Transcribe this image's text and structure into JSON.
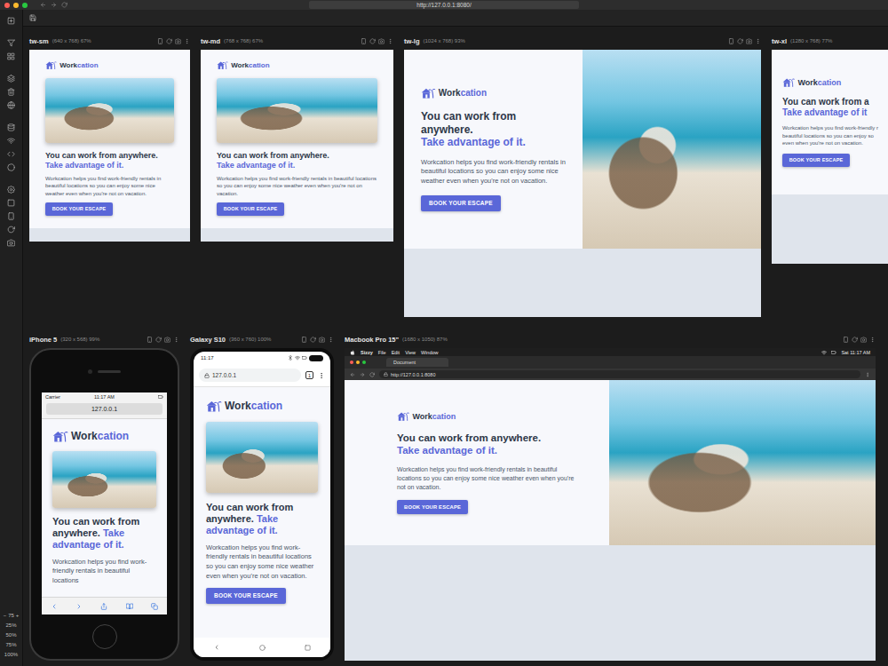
{
  "app": {
    "url": "http://127.0.0.1:8080/"
  },
  "zoom": {
    "decrease": "−",
    "value": "75",
    "increase": "+",
    "presets": [
      "25%",
      "50%",
      "75%",
      "100%"
    ]
  },
  "page": {
    "brand": [
      "Work",
      "cation"
    ],
    "headline": "You can work from anywhere.",
    "accent": "Take advantage of it.",
    "body": "Workcation helps you find work-friendly rentals in beautiful locations so you can enjoy some nice weather even when you're not on vacation.",
    "cta": "BOOK YOUR ESCAPE"
  },
  "device_rows": [
    {
      "devices": [
        {
          "name": "tw-sm",
          "meta": "(640 x 768) 67%",
          "kind": "viewport-stacked"
        },
        {
          "name": "tw-md",
          "meta": "(768 x 768) 67%",
          "kind": "viewport-stacked"
        },
        {
          "name": "tw-lg",
          "meta": "(1024 x 768) 93%",
          "kind": "viewport-split"
        },
        {
          "name": "tw-xl",
          "meta": "(1280 x 768) 77%",
          "kind": "viewport-clipped",
          "page": {
            "headline": "You can work from a",
            "accent": "Take advantage of it",
            "body_lines": [
              "Workcation helps you find work-friendly r",
              "beautiful locations so you can enjoy so",
              "even when you're not on vacation."
            ]
          }
        }
      ]
    },
    {
      "devices": [
        {
          "name": "iPhone 5",
          "meta": "(320 x 568) 99%",
          "kind": "iphone",
          "carrier": "Carrier",
          "time": "11:17 AM",
          "address": "127.0.0.1",
          "page": {
            "body": "Workcation helps you find work-friendly rentals in beautiful locations",
            "cta": null
          }
        },
        {
          "name": "Galaxy S10",
          "meta": "(360 x 760) 100%",
          "kind": "android",
          "time": "11:17",
          "address": "127.0.0.1",
          "tab_count": "1"
        },
        {
          "name": "Macbook Pro 15\"",
          "meta": "(1680 x 1050) 87%",
          "kind": "macbook",
          "menu": [
            "Sizzy",
            "File",
            "Edit",
            "View",
            "Window"
          ],
          "clock": "Sat 11:17 AM",
          "tab": "Document",
          "address": "http://127.0.0.1:8080"
        }
      ]
    }
  ]
}
